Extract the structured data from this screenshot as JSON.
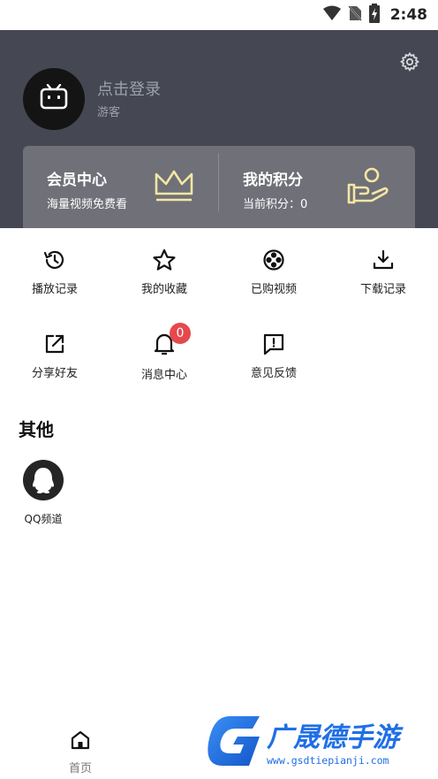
{
  "status_bar": {
    "time": "2:48"
  },
  "header": {
    "login_text": "点击登录",
    "guest_text": "游客",
    "cards": {
      "vip": {
        "title": "会员中心",
        "subtitle": "海量视频免费看"
      },
      "points": {
        "title": "我的积分",
        "subtitle": "当前积分：0"
      }
    }
  },
  "menu": {
    "items": [
      {
        "label": "播放记录",
        "icon": "history-icon"
      },
      {
        "label": "我的收藏",
        "icon": "star-icon"
      },
      {
        "label": "已购视频",
        "icon": "film-reel-icon"
      },
      {
        "label": "下载记录",
        "icon": "download-icon"
      },
      {
        "label": "分享好友",
        "icon": "share-icon"
      },
      {
        "label": "消息中心",
        "icon": "bell-icon",
        "badge": "0"
      },
      {
        "label": "意见反馈",
        "icon": "feedback-icon"
      }
    ]
  },
  "other": {
    "title": "其他",
    "items": [
      {
        "label": "QQ频道",
        "icon": "qq-icon"
      }
    ]
  },
  "bottom_nav": {
    "home_label": "首页"
  },
  "watermark": {
    "name": "广晟德手游",
    "url": "www.gsdtiepianji.com"
  },
  "colors": {
    "header_bg": "#454752",
    "card_bg": "#6f7078",
    "accent_gold": "#f4e6a3",
    "badge_red": "#e5484d"
  }
}
